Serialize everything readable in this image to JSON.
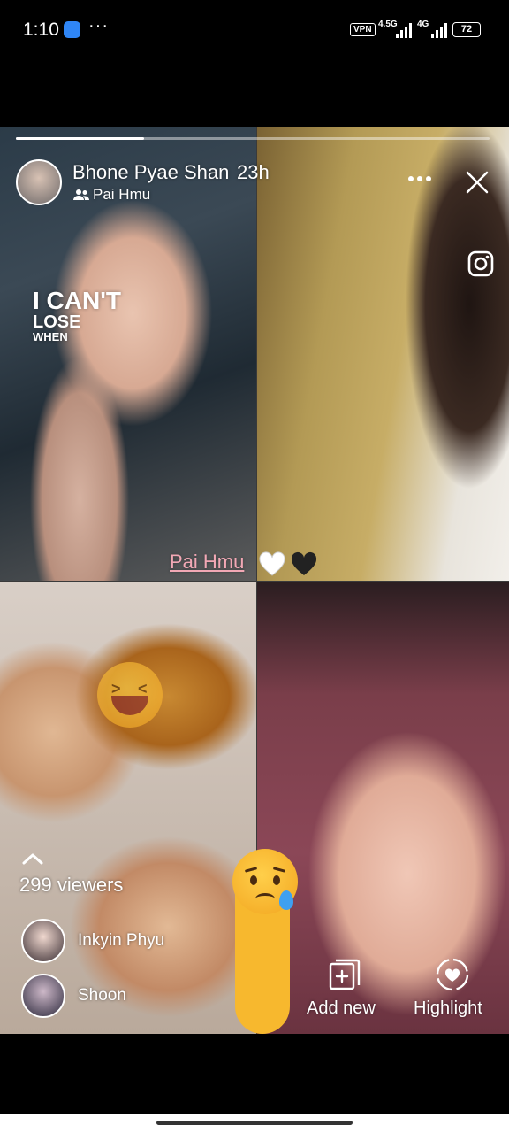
{
  "status_bar": {
    "time": "1:10",
    "vpn": "VPN",
    "network1": "4.5G",
    "network2": "4G",
    "battery": "72"
  },
  "story": {
    "progress": 0.27,
    "author": "Bhone Pyae Shan",
    "time_ago": "23h",
    "group": "Pai Hmu",
    "sticker_text": {
      "line1": "I CAN'T",
      "line2": "LOSE",
      "line3": "WHEN"
    },
    "mention": "Pai Hmu"
  },
  "viewers": {
    "count_label": "299 viewers",
    "list": [
      {
        "name": "Inkyin Phyu"
      },
      {
        "name": "Shoon"
      }
    ]
  },
  "actions": {
    "add_new": "Add new",
    "highlight": "Highlight"
  },
  "colors": {
    "mention": "#f2a8b5",
    "background": "#000000"
  },
  "icons": [
    "more-icon",
    "close-icon",
    "instagram-icon",
    "group-icon",
    "chevron-up-icon",
    "add-new-icon",
    "highlight-icon"
  ]
}
